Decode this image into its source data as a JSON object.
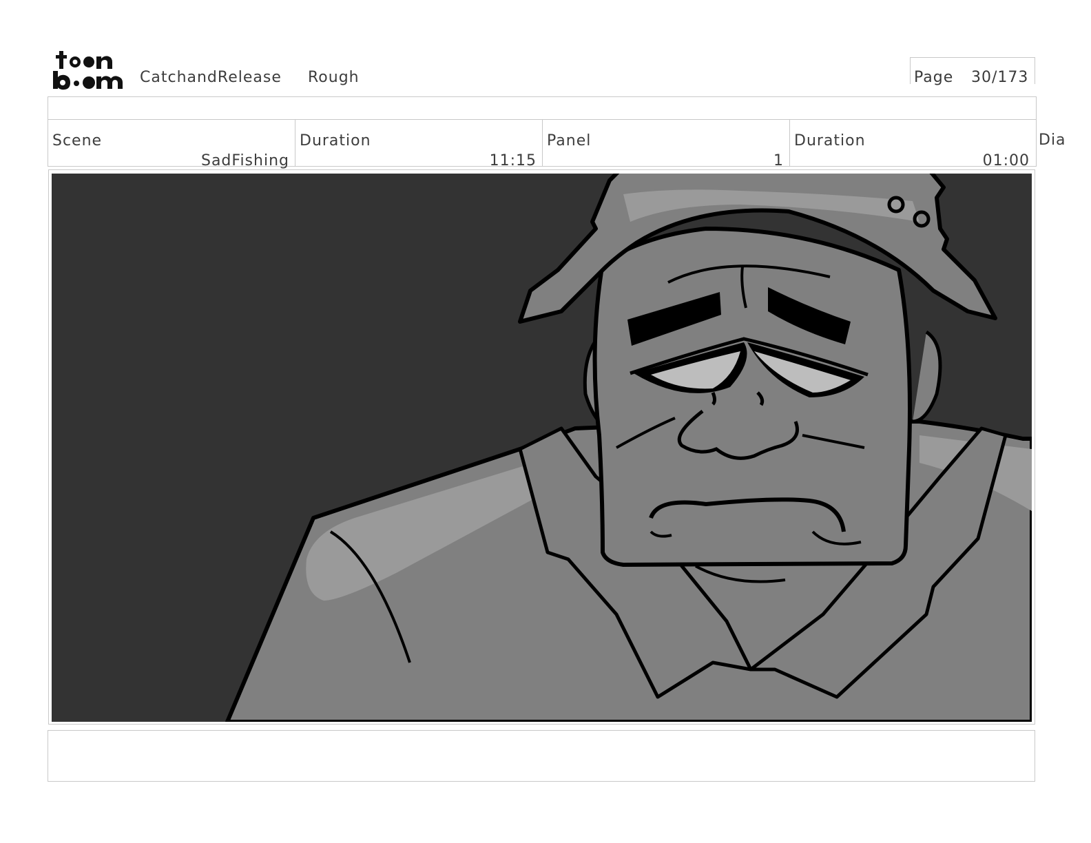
{
  "header": {
    "logo_alt": "toon boom",
    "project": "CatchandRelease",
    "stage": "Rough",
    "page_label": "Page",
    "page_value": "30/173"
  },
  "info": {
    "scene_label": "Scene",
    "scene_value": "SadFishing",
    "scene_duration_label": "Duration",
    "scene_duration_value": "11:15",
    "panel_label": "Panel",
    "panel_value": "1",
    "panel_duration_label": "Duration",
    "panel_duration_value": "01:00",
    "dialogue_label": "Dia"
  },
  "colors": {
    "background_dark": "#333333",
    "skin_gray": "#808080",
    "highlight_gray": "#9a9a9a",
    "line": "#000000"
  }
}
